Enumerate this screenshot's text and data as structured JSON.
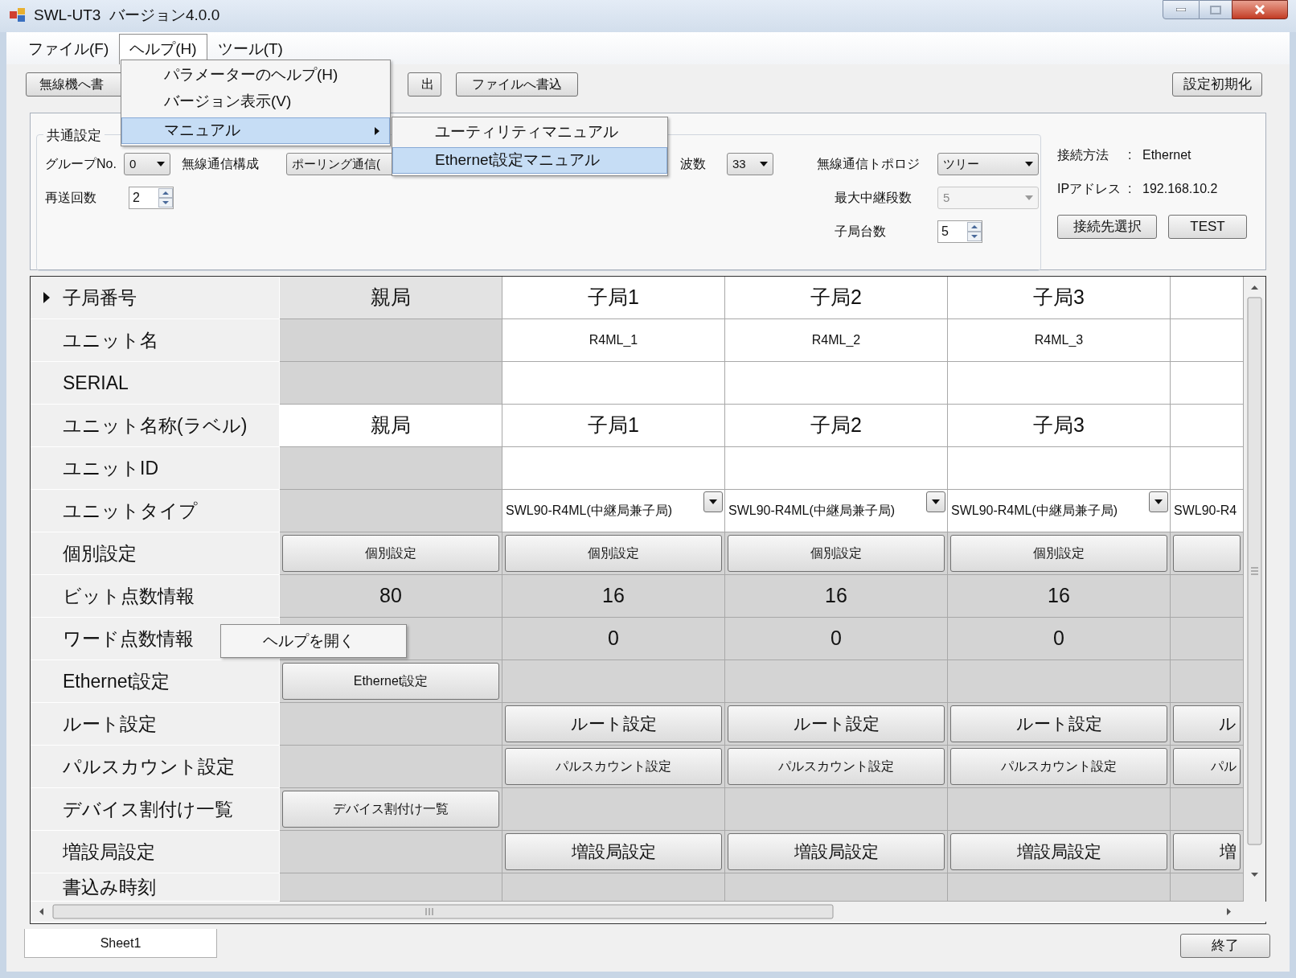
{
  "window": {
    "title": "SWL-UT3  バージョン4.0.0"
  },
  "menu_bar": [
    {
      "label": "ファイル(F)",
      "selected": false
    },
    {
      "label": "ヘルプ(H)",
      "selected": true
    },
    {
      "label": "ツール(T)",
      "selected": false
    }
  ],
  "help_menu": [
    {
      "label": "パラメーターのヘルプ(H)",
      "selected": false,
      "has_submenu": false
    },
    {
      "label": "バージョン表示(V)",
      "selected": false,
      "has_submenu": false
    },
    {
      "label": "マニュアル",
      "selected": true,
      "has_submenu": true
    }
  ],
  "manual_submenu": [
    {
      "label": "ユーティリティマニュアル",
      "selected": false
    },
    {
      "label": "Ethernet設定マニュアル",
      "selected": true
    }
  ],
  "toolbar": [
    "無線機へ書",
    "出",
    "ファイルへ書込"
  ],
  "reset_button": "設定初期化",
  "common_settings": {
    "title": "共通設定",
    "group_no": {
      "label": "グループNo.",
      "value": "0"
    },
    "wireless_config": {
      "label": "無線通信構成",
      "value": "ポーリング通信("
    },
    "frequency": {
      "label": "波数",
      "value": "33"
    },
    "topology": {
      "label": "無線通信トポロジ",
      "value": "ツリー"
    },
    "max_relay": {
      "label": "最大中継段数",
      "value": "5",
      "disabled": true
    },
    "slave_count": {
      "label": "子局台数",
      "value": "5"
    },
    "retry": {
      "label": "再送回数",
      "value": "2"
    }
  },
  "connection": {
    "rows": [
      {
        "label": "接続方法",
        "separator": ":",
        "value": "Ethernet"
      },
      {
        "label": "IPアドレス",
        "separator": ":",
        "value": "192.168.10.2"
      }
    ],
    "buttons": [
      "接続先選択",
      "TEST"
    ]
  },
  "grid": {
    "rows": [
      {
        "label": "子局番号",
        "selected": true,
        "cells": [
          {
            "kind": "head",
            "text": "親局"
          },
          {
            "kind": "big",
            "text": "子局1"
          },
          {
            "kind": "big",
            "text": "子局2"
          },
          {
            "kind": "big",
            "text": "子局3"
          },
          {
            "kind": "empty"
          }
        ]
      },
      {
        "label": "ユニット名",
        "selected": false,
        "cells": [
          {
            "kind": "blank"
          },
          {
            "kind": "small",
            "text": "R4ML_1"
          },
          {
            "kind": "small",
            "text": "R4ML_2"
          },
          {
            "kind": "small",
            "text": "R4ML_3"
          },
          {
            "kind": "empty"
          }
        ]
      },
      {
        "label": "SERIAL",
        "selected": false,
        "cells": [
          {
            "kind": "blank"
          },
          {
            "kind": "empty"
          },
          {
            "kind": "empty"
          },
          {
            "kind": "empty"
          },
          {
            "kind": "empty"
          }
        ]
      },
      {
        "label": "ユニット名称(ラベル)",
        "selected": false,
        "cells": [
          {
            "kind": "big",
            "text": "親局"
          },
          {
            "kind": "big",
            "text": "子局1"
          },
          {
            "kind": "big",
            "text": "子局2"
          },
          {
            "kind": "big",
            "text": "子局3"
          },
          {
            "kind": "empty"
          }
        ]
      },
      {
        "label": "ユニットID",
        "selected": false,
        "cells": [
          {
            "kind": "blank"
          },
          {
            "kind": "empty"
          },
          {
            "kind": "empty"
          },
          {
            "kind": "empty"
          },
          {
            "kind": "empty"
          }
        ]
      },
      {
        "label": "ユニットタイプ",
        "selected": false,
        "cells": [
          {
            "kind": "blank"
          },
          {
            "kind": "combo",
            "text": "SWL90-R4ML(中継局兼子局)"
          },
          {
            "kind": "combo",
            "text": "SWL90-R4ML(中継局兼子局)"
          },
          {
            "kind": "combo",
            "text": "SWL90-R4ML(中継局兼子局)"
          },
          {
            "kind": "combo",
            "text": "SWL90-R4"
          }
        ]
      },
      {
        "label": "個別設定",
        "selected": false,
        "cells": [
          {
            "kind": "button",
            "text": "個別設定"
          },
          {
            "kind": "button",
            "text": "個別設定"
          },
          {
            "kind": "button",
            "text": "個別設定"
          },
          {
            "kind": "button",
            "text": "個別設定"
          },
          {
            "kind": "button"
          }
        ]
      },
      {
        "label": "ビット点数情報",
        "selected": false,
        "cells": [
          {
            "kind": "num",
            "text": "80"
          },
          {
            "kind": "num",
            "text": "16"
          },
          {
            "kind": "num",
            "text": "16"
          },
          {
            "kind": "num",
            "text": "16"
          },
          {
            "kind": "blank"
          }
        ]
      },
      {
        "label": "ワード点数情報",
        "selected": false,
        "cells": [
          {
            "kind": "blank"
          },
          {
            "kind": "num",
            "text": "0"
          },
          {
            "kind": "num",
            "text": "0"
          },
          {
            "kind": "num",
            "text": "0"
          },
          {
            "kind": "blank"
          }
        ]
      },
      {
        "label": "Ethernet設定",
        "selected": false,
        "cells": [
          {
            "kind": "button",
            "text": "Ethernet設定"
          },
          {
            "kind": "blank"
          },
          {
            "kind": "blank"
          },
          {
            "kind": "blank"
          },
          {
            "kind": "blank"
          }
        ]
      },
      {
        "label": "ルート設定",
        "selected": false,
        "cells": [
          {
            "kind": "blank"
          },
          {
            "kind": "bigbutton",
            "text": "ルート設定"
          },
          {
            "kind": "bigbutton",
            "text": "ルート設定"
          },
          {
            "kind": "bigbutton",
            "text": "ルート設定"
          },
          {
            "kind": "bigbutton",
            "text": "ル"
          }
        ]
      },
      {
        "label": "パルスカウント設定",
        "selected": false,
        "cells": [
          {
            "kind": "blank"
          },
          {
            "kind": "button",
            "text": "パルスカウント設定"
          },
          {
            "kind": "button",
            "text": "パルスカウント設定"
          },
          {
            "kind": "button",
            "text": "パルスカウント設定"
          },
          {
            "kind": "button",
            "text": "パル"
          }
        ]
      },
      {
        "label": "デバイス割付け一覧",
        "selected": false,
        "cells": [
          {
            "kind": "button",
            "text": "デバイス割付け一覧"
          },
          {
            "kind": "blank"
          },
          {
            "kind": "blank"
          },
          {
            "kind": "blank"
          },
          {
            "kind": "blank"
          }
        ]
      },
      {
        "label": "増設局設定",
        "selected": false,
        "cells": [
          {
            "kind": "blank"
          },
          {
            "kind": "bigbutton",
            "text": "増設局設定"
          },
          {
            "kind": "bigbutton",
            "text": "増設局設定"
          },
          {
            "kind": "bigbutton",
            "text": "増設局設定"
          },
          {
            "kind": "bigbutton",
            "text": "増"
          }
        ]
      },
      {
        "label": "書込み時刻",
        "selected": false,
        "cells": [
          {
            "kind": "blank"
          },
          {
            "kind": "blank"
          },
          {
            "kind": "blank"
          },
          {
            "kind": "blank"
          },
          {
            "kind": "blank"
          }
        ]
      }
    ]
  },
  "context_menu": [
    "ヘルプを開く"
  ],
  "sheet_tab": "Sheet1",
  "exit_button": "終了"
}
